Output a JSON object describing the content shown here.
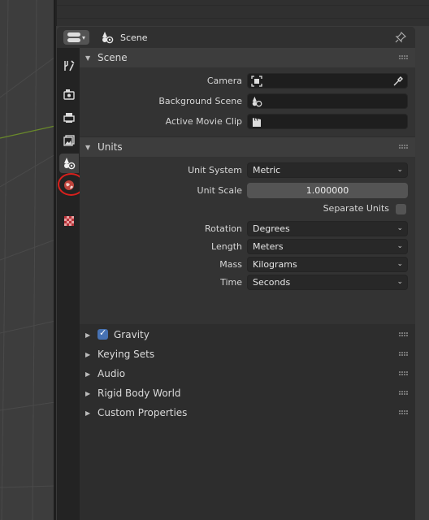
{
  "header": {
    "context_label": "Scene"
  },
  "tabs": [
    {
      "name": "tab-tool",
      "icon": "tool-icon"
    },
    {
      "name": "tab-render",
      "icon": "render-icon"
    },
    {
      "name": "tab-output",
      "icon": "output-icon"
    },
    {
      "name": "tab-view-layer",
      "icon": "view-layer-icon"
    },
    {
      "name": "tab-scene",
      "icon": "scene-icon",
      "active": true
    },
    {
      "name": "tab-world",
      "icon": "world-icon"
    },
    {
      "name": "tab-texture",
      "icon": "texture-icon"
    }
  ],
  "scene_panel": {
    "title": "Scene",
    "camera_label": "Camera",
    "background_scene_label": "Background Scene",
    "active_movie_clip_label": "Active Movie Clip"
  },
  "units_panel": {
    "title": "Units",
    "unit_system_label": "Unit System",
    "unit_system_value": "Metric",
    "unit_scale_label": "Unit Scale",
    "unit_scale_value": "1.000000",
    "separate_units_label": "Separate Units",
    "rotation_label": "Rotation",
    "rotation_value": "Degrees",
    "length_label": "Length",
    "length_value": "Meters",
    "mass_label": "Mass",
    "mass_value": "Kilograms",
    "time_label": "Time",
    "time_value": "Seconds"
  },
  "collapsed_panels": {
    "gravity": "Gravity",
    "keying_sets": "Keying Sets",
    "audio": "Audio",
    "rigid_body_world": "Rigid Body World",
    "custom_properties": "Custom Properties"
  },
  "colors": {
    "accent": "#4772b3",
    "highlight": "#d8201c"
  }
}
